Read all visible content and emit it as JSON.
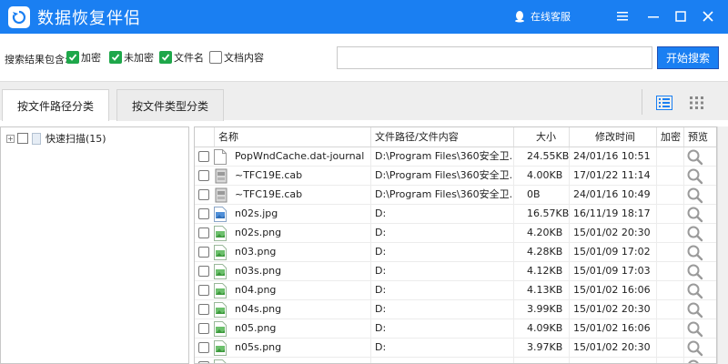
{
  "app": {
    "title": "数据恢复伴侣",
    "service_label": "在线客服"
  },
  "search": {
    "filter_label": "搜索结果包含:",
    "options": [
      {
        "label": "加密",
        "checked": true
      },
      {
        "label": "未加密",
        "checked": true
      },
      {
        "label": "文件名",
        "checked": true
      },
      {
        "label": "文档内容",
        "checked": false
      }
    ],
    "input_value": "",
    "button_label": "开始搜索"
  },
  "tabs": [
    {
      "label": "按文件路径分类",
      "active": true
    },
    {
      "label": "按文件类型分类",
      "active": false
    }
  ],
  "tree": {
    "root_label": "快速扫描(15)"
  },
  "table": {
    "columns": [
      "名称",
      "文件路径/文件内容",
      "大小",
      "修改时间",
      "加密",
      "预览"
    ],
    "rows": [
      {
        "name": "PopWndCache.dat-journal",
        "path": "D:\\Program Files\\360安全卫...",
        "size": "24.55KB",
        "date": "24/01/16 10:51",
        "icon": "blank-file-icon"
      },
      {
        "name": "~TFC19E.cab",
        "path": "D:\\Program Files\\360安全卫...",
        "size": "4.00KB",
        "date": "17/01/22 11:14",
        "icon": "cab-file-icon"
      },
      {
        "name": "~TFC19E.cab",
        "path": "D:\\Program Files\\360安全卫...",
        "size": "0B",
        "date": "24/01/16 10:49",
        "icon": "cab-file-icon"
      },
      {
        "name": "n02s.jpg",
        "path": "D:",
        "size": "16.57KB",
        "date": "16/11/19 18:17",
        "icon": "jpg-file-icon"
      },
      {
        "name": "n02s.png",
        "path": "D:",
        "size": "4.20KB",
        "date": "15/01/02 20:30",
        "icon": "png-file-icon"
      },
      {
        "name": "n03.png",
        "path": "D:",
        "size": "4.28KB",
        "date": "15/01/09 17:02",
        "icon": "png-file-icon"
      },
      {
        "name": "n03s.png",
        "path": "D:",
        "size": "4.12KB",
        "date": "15/01/09 17:03",
        "icon": "png-file-icon"
      },
      {
        "name": "n04.png",
        "path": "D:",
        "size": "4.13KB",
        "date": "15/01/02 16:06",
        "icon": "png-file-icon"
      },
      {
        "name": "n04s.png",
        "path": "D:",
        "size": "3.99KB",
        "date": "15/01/02 20:30",
        "icon": "png-file-icon"
      },
      {
        "name": "n05.png",
        "path": "D:",
        "size": "4.09KB",
        "date": "15/01/02 16:06",
        "icon": "png-file-icon"
      },
      {
        "name": "n05s.png",
        "path": "D:",
        "size": "3.97KB",
        "date": "15/01/02 20:30",
        "icon": "png-file-icon"
      },
      {
        "name": "",
        "path": "",
        "size": "",
        "date": "",
        "icon": "png-file-icon"
      }
    ]
  },
  "colors": {
    "brand": "#1a7ff2",
    "checkbox_on": "#1ea74a"
  }
}
